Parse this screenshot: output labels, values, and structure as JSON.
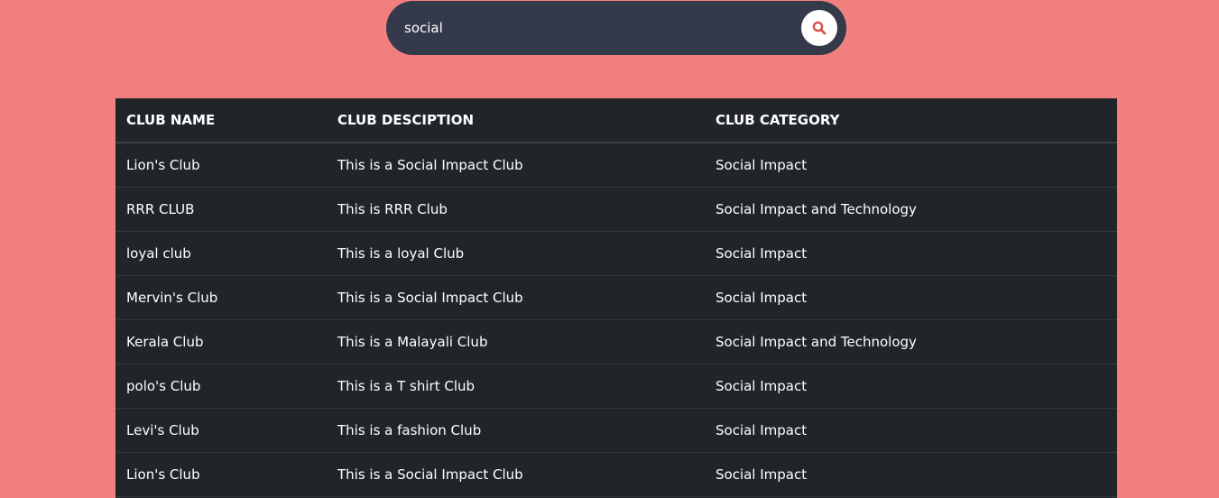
{
  "search": {
    "value": "social",
    "button_icon": "search-icon"
  },
  "colors": {
    "page_background": "#f07f7d",
    "search_bar": "#343a4a",
    "table_background": "#212529",
    "search_icon": "#d9534f"
  },
  "table": {
    "headers": [
      "CLUB NAME",
      "CLUB DESCIPTION",
      "CLUB CATEGORY"
    ],
    "rows": [
      [
        "Lion's Club",
        "This is a Social Impact Club",
        "Social Impact"
      ],
      [
        "RRR CLUB",
        "This is RRR Club",
        "Social Impact and Technology"
      ],
      [
        "loyal club",
        "This is a loyal Club",
        "Social Impact"
      ],
      [
        "Mervin's Club",
        "This is a Social Impact Club",
        "Social Impact"
      ],
      [
        "Kerala Club",
        "This is a Malayali Club",
        "Social Impact and Technology"
      ],
      [
        "polo's Club",
        "This is a T shirt Club",
        "Social Impact"
      ],
      [
        "Levi's Club",
        "This is a fashion Club",
        "Social Impact"
      ],
      [
        "Lion's Club",
        "This is a Social Impact Club",
        "Social Impact"
      ]
    ]
  }
}
